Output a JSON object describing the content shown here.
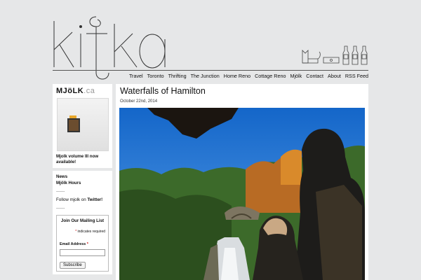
{
  "site": {
    "logo_text": "kitka"
  },
  "nav": {
    "items": [
      "Travel",
      "Toronto",
      "Thrifting",
      "The Junction",
      "Home Reno",
      "Cottage Reno",
      "Mjölk",
      "Contact",
      "About",
      "RSS Feed"
    ]
  },
  "sidebar": {
    "mjolk_logo_main": "MJöLK",
    "mjolk_logo_suffix": ".ca",
    "promo_text": "Mjolk volume III now available!",
    "links": {
      "news": "News",
      "hours": "Mjölk Hours",
      "divider": "------",
      "follow_prefix": "Follow mjolk on ",
      "follow_link": "Twitter!"
    },
    "mailing": {
      "title": "Join Our Mailing List",
      "required_note": "indicates required",
      "required_star": "*",
      "email_label": "Email Address",
      "email_value": "",
      "subscribe_label": "Subscribe"
    }
  },
  "post": {
    "title": "Waterfalls of Hamilton",
    "date": "October 22nd, 2014"
  },
  "colors": {
    "background": "#e6e7e8",
    "panel": "#ffffff",
    "sky": "#1a6fd0",
    "required": "#cc0000"
  }
}
